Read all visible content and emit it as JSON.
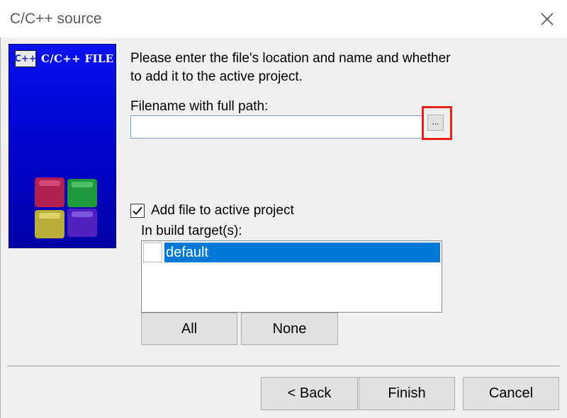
{
  "window": {
    "title": "C/C++ source",
    "close_icon": "close-icon"
  },
  "banner": {
    "icon_text": "C++",
    "text": "C/C++ FILE"
  },
  "form": {
    "instructions": "Please enter the file's location and name and whether to add it to the active project.",
    "path_label": "Filename with full path:",
    "path_value": "",
    "browse_label": "...",
    "add_to_project_label": "Add file to active project",
    "add_to_project_checked": true,
    "targets_label": "In build target(s):",
    "targets": [
      {
        "label": "default",
        "checked": false,
        "selected": true
      }
    ],
    "all_label": "All",
    "none_label": "None"
  },
  "footer": {
    "back_label": "< Back",
    "finish_label": "Finish",
    "cancel_label": "Cancel"
  },
  "colors": {
    "selection": "#0078d7",
    "highlight_border": "#e8221b",
    "banner_blue": "#0006d0"
  }
}
